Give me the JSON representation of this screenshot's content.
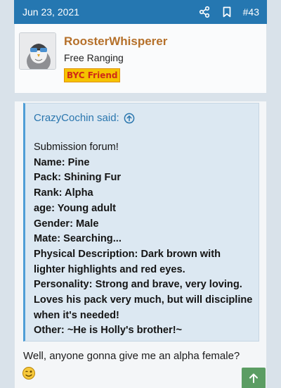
{
  "post": {
    "date": "Jun 23, 2021",
    "number": "#43",
    "header_color": "#2577b1"
  },
  "user": {
    "name": "RoosterWhisperer",
    "title": "Free Ranging",
    "badge": "BYC Friend",
    "avatar": "falcon-avatar"
  },
  "quote": {
    "attribution": "CrazyCochin said:",
    "lines": [
      {
        "text": "Submission forum!",
        "style": "plain"
      },
      {
        "text": "Name: Pine",
        "style": "bold"
      },
      {
        "text": "Pack: Shining Fur",
        "style": "bold"
      },
      {
        "text": "Rank: Alpha",
        "style": "bold"
      },
      {
        "text": "age: Young adult",
        "style": "bold"
      },
      {
        "text": "Gender: Male",
        "style": "bold"
      },
      {
        "text": "Mate: Searching...",
        "style": "bold"
      },
      {
        "text": "Physical Description: Dark brown with",
        "style": "bold"
      },
      {
        "text": "lighter highlights and red eyes.",
        "style": "bold"
      },
      {
        "text": "Personality: Strong and brave, very loving.",
        "style": "bold"
      },
      {
        "text": "Loves his pack very much, but will discipline",
        "style": "bold"
      },
      {
        "text": "when it's needed!",
        "style": "bold"
      },
      {
        "text": "Other: ~He is Holly's brother!~",
        "style": "bold"
      }
    ]
  },
  "reply": {
    "text": "Well, anyone gonna give me an alpha female?",
    "emoji": "wink-face-icon"
  },
  "colors": {
    "username": "#b5702a",
    "badge_bg": "#f5c300",
    "badge_text": "#d02b16",
    "quote_accent": "#4f9ed6",
    "scroll_button": "#5b9d63"
  }
}
